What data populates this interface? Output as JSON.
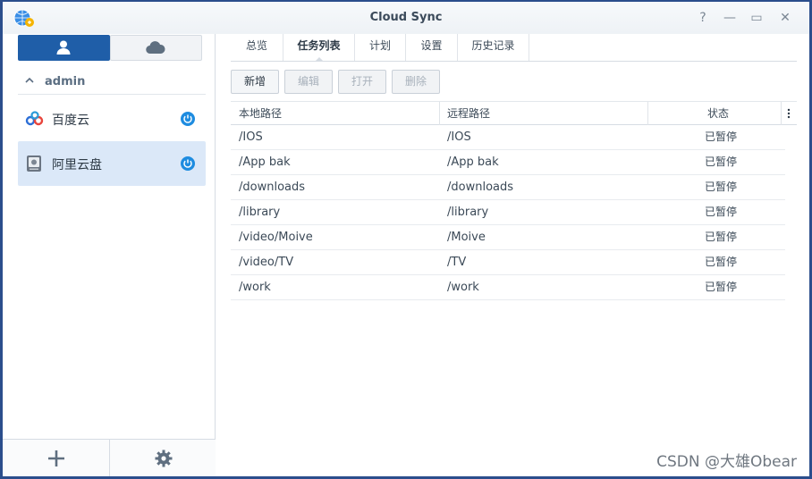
{
  "window": {
    "title": "Cloud Sync"
  },
  "titlebar": {
    "help_glyph": "?",
    "minimize_glyph": "—",
    "maximize_glyph": "▭",
    "close_glyph": "✕"
  },
  "sidebar": {
    "group_label": "admin",
    "accounts": [
      {
        "label": "百度云",
        "icon": "baidu-cloud-icon",
        "selected": false
      },
      {
        "label": "阿里云盘",
        "icon": "aliyun-drive-icon",
        "selected": true
      }
    ],
    "bottom": {
      "add_glyph": "+",
      "settings_icon": "gear-icon"
    }
  },
  "tabs": [
    "总览",
    "任务列表",
    "计划",
    "设置",
    "历史记录"
  ],
  "active_tab": "任务列表",
  "toolbar": {
    "add": "新增",
    "edit": "编辑",
    "open": "打开",
    "delete": "删除"
  },
  "table": {
    "headers": {
      "local": "本地路径",
      "remote": "远程路径",
      "status": "状态"
    },
    "rows": [
      {
        "local": "/IOS",
        "remote": "/IOS",
        "status": "已暂停"
      },
      {
        "local": "/App bak",
        "remote": "/App bak",
        "status": "已暂停"
      },
      {
        "local": "/downloads",
        "remote": "/downloads",
        "status": "已暂停"
      },
      {
        "local": "/library",
        "remote": "/library",
        "status": "已暂停"
      },
      {
        "local": "/video/Moive",
        "remote": "/Moive",
        "status": "已暂停"
      },
      {
        "local": "/video/TV",
        "remote": "/TV",
        "status": "已暂停"
      },
      {
        "local": "/work",
        "remote": "/work",
        "status": "已暂停"
      }
    ]
  },
  "watermark": "CSDN @大雄Obear",
  "colors": {
    "accent": "#1f5ea8",
    "power": "#1e8ce0",
    "selected_row": "#dbe8f8",
    "desktop": "#2b4e8c"
  }
}
